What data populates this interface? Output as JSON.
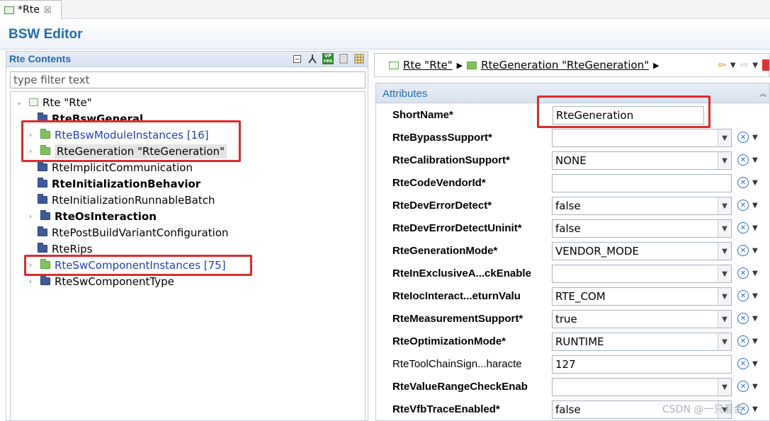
{
  "tab": {
    "label": "*Rte",
    "close": "☒"
  },
  "editor": {
    "title": "BSW Editor"
  },
  "left": {
    "title": "Rte Contents",
    "filter_placeholder": "type filter text",
    "tree": {
      "root": "Rte \"Rte\"",
      "items": [
        {
          "label": "RteBswGeneral"
        },
        {
          "label": "RteBswModuleInstances [16]"
        },
        {
          "label": "RteGeneration \"RteGeneration\""
        },
        {
          "label": "RteImplicitCommunication"
        },
        {
          "label": "RteInitializationBehavior"
        },
        {
          "label": "RteInitializationRunnableBatch"
        },
        {
          "label": "RteOsInteraction"
        },
        {
          "label": "RtePostBuildVariantConfiguration"
        },
        {
          "label": "RteRips"
        },
        {
          "label": "RteSwComponentInstances [75]"
        },
        {
          "label": "RteSwComponentType"
        }
      ]
    }
  },
  "right": {
    "breadcrumb": [
      {
        "label": "Rte \"Rte\""
      },
      {
        "label": "RteGeneration \"RteGeneration\""
      }
    ],
    "attributes_title": "Attributes",
    "attributes": [
      {
        "name": "ShortName*",
        "value": "RteGeneration"
      },
      {
        "name": "RteBypassSupport*",
        "value": ""
      },
      {
        "name": "RteCalibrationSupport*",
        "value": "NONE"
      },
      {
        "name": "RteCodeVendorId*",
        "value": ""
      },
      {
        "name": "RteDevErrorDetect*",
        "value": "false"
      },
      {
        "name": "RteDevErrorDetectUninit*",
        "value": "false"
      },
      {
        "name": "RteGenerationMode*",
        "value": "VENDOR_MODE"
      },
      {
        "name": "RteInExclusiveA...ckEnable",
        "value": ""
      },
      {
        "name": "RteIocInteract...eturnValu",
        "value": "RTE_COM"
      },
      {
        "name": "RteMeasurementSupport*",
        "value": "true"
      },
      {
        "name": "RteOptimizationMode*",
        "value": "RUNTIME"
      },
      {
        "name": "RteToolChainSign...haracte",
        "value": "127"
      },
      {
        "name": "RteValueRangeCheckEnab",
        "value": ""
      },
      {
        "name": "RteVfbTraceEnabled*",
        "value": "false"
      }
    ]
  },
  "watermark": "CSDN @一只混合"
}
